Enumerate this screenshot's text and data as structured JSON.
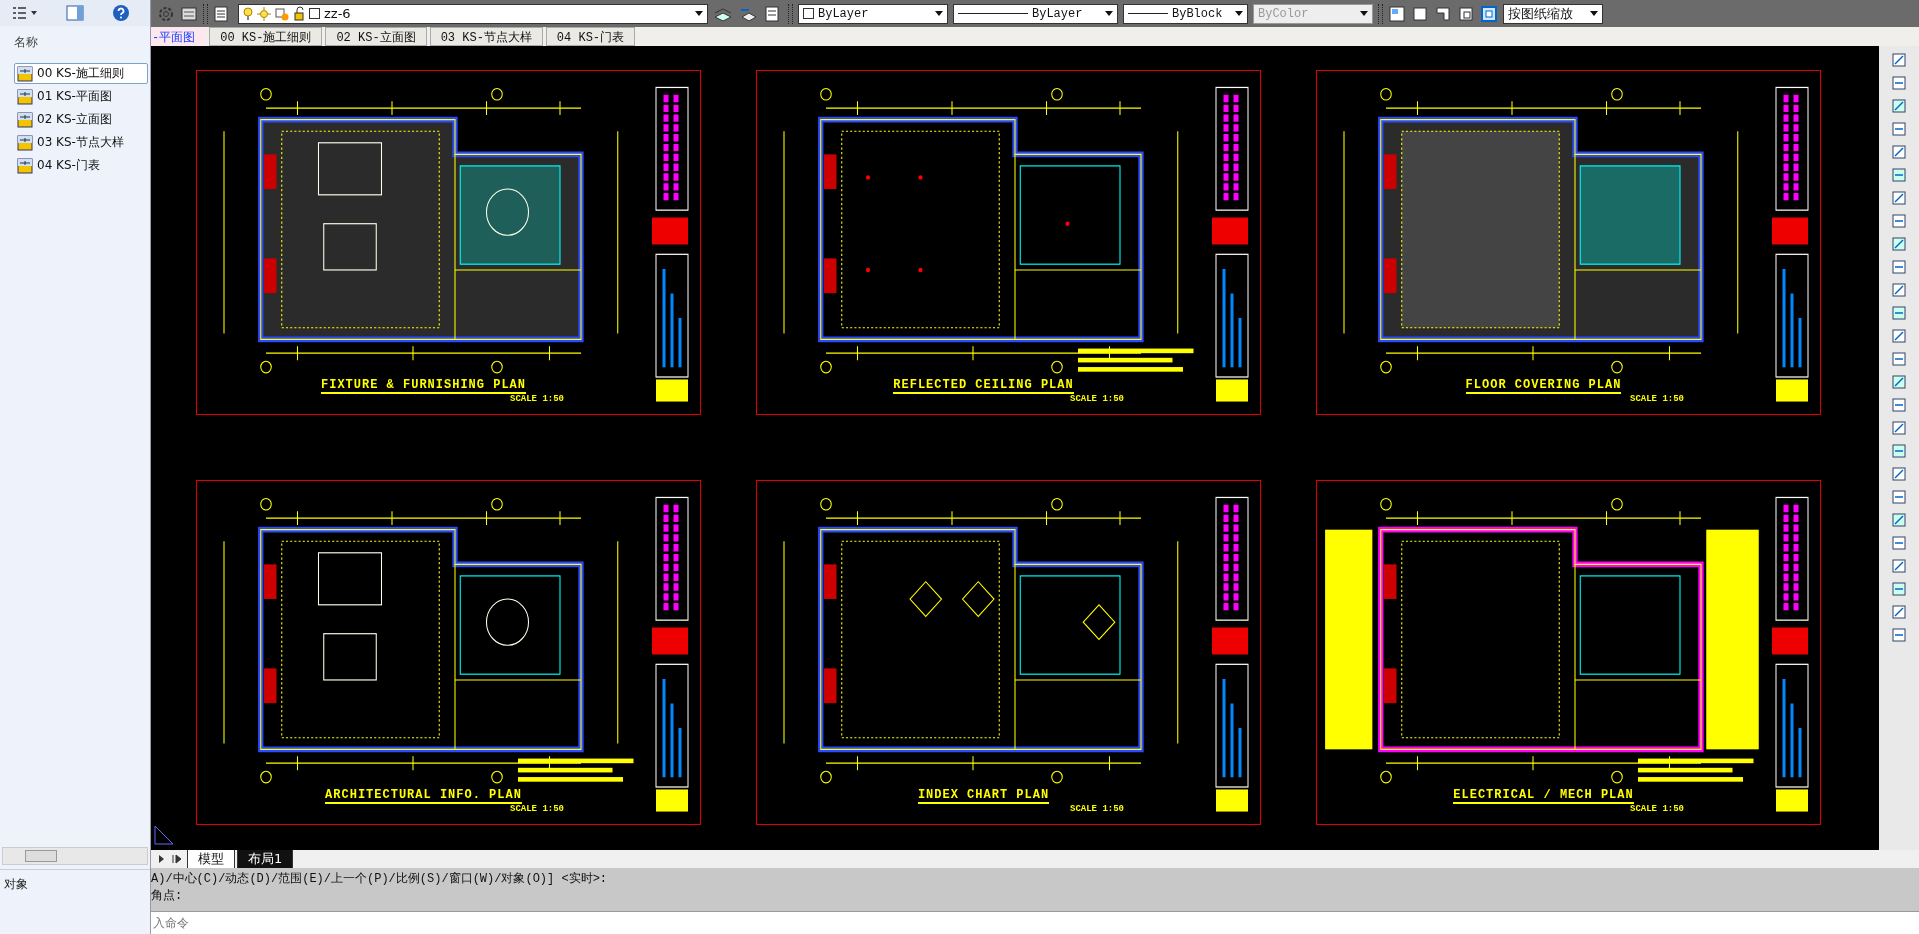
{
  "toolbar": {
    "layer": "zz-6",
    "color_control": "ByLayer",
    "linetype": "ByLayer",
    "lineweight": "ByBlock",
    "plot_style": {
      "label": "ByColor",
      "disabled": true
    },
    "scale": "按图纸缩放"
  },
  "file_tabs": [
    {
      "label": "-平面图",
      "selected": true
    },
    {
      "label": "00 KS-施工细则",
      "selected": false
    },
    {
      "label": "02 KS-立面图",
      "selected": false
    },
    {
      "label": "03 KS-节点大样",
      "selected": false
    },
    {
      "label": "04 KS-门表",
      "selected": false
    }
  ],
  "sidebar": {
    "header": "名称",
    "items": [
      {
        "label": "00 KS-施工细则",
        "selected": true
      },
      {
        "label": "01 KS-平面图",
        "selected": false
      },
      {
        "label": "02 KS-立面图",
        "selected": false
      },
      {
        "label": "03 KS-节点大样",
        "selected": false
      },
      {
        "label": "04 KS-门表",
        "selected": false
      }
    ],
    "footer": "对象"
  },
  "sheets": [
    {
      "title": "FIXTURE & FURNISHING PLAN",
      "scale": "SCALE 1:50",
      "kind": "furnishing"
    },
    {
      "title": "REFLECTED CEILING PLAN",
      "scale": "SCALE 1:50",
      "kind": "ceiling"
    },
    {
      "title": "FLOOR COVERING PLAN",
      "scale": "SCALE 1:50",
      "kind": "floor"
    },
    {
      "title": "ARCHITECTURAL INFO. PLAN",
      "scale": "SCALE 1:50",
      "kind": "architectural"
    },
    {
      "title": "INDEX CHART PLAN",
      "scale": "SCALE 1:50",
      "kind": "index"
    },
    {
      "title": "ELECTRICAL / MECH PLAN",
      "scale": "SCALE 1:50",
      "kind": "electrical"
    }
  ],
  "layout_tabs": [
    {
      "label": "模型",
      "selected": false
    },
    {
      "label": "布局1",
      "selected": true
    }
  ],
  "command": {
    "history": [
      "A)/中心(C)/动态(D)/范围(E)/上一个(P)/比例(S)/窗口(W)/对象(O)] <实时>:",
      "角点:"
    ],
    "placeholder": "入命令"
  }
}
